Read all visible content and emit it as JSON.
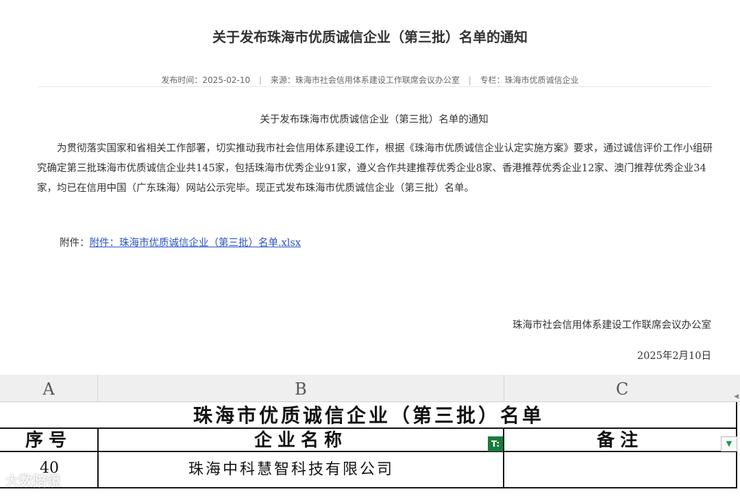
{
  "article": {
    "title": "关于发布珠海市优质诚信企业（第三批）名单的通知",
    "meta": {
      "publish_label": "发布时间：",
      "publish_date": "2025-02-10",
      "source_label": "来源：",
      "source": "珠海市社会信用体系建设工作联席会议办公室",
      "column_label": "专栏：",
      "column": "珠海市优质诚信企业",
      "separator": "|"
    },
    "subtitle": "关于发布珠海市优质诚信企业（第三批）名单的通知",
    "body": "为贯彻落实国家和省相关工作部署，切实推动我市社会信用体系建设工作，根据《珠海市优质诚信企业认定实施方案》要求，通过诚信评价工作小组研究确定第三批珠海市优质诚信企业共145家，包括珠海市优秀企业91家，遵义合作共建推荐优秀企业8家、香港推荐优秀企业12家、澳门推荐优秀企业34家，均已在信用中国（广东珠海）网站公示完毕。现正式发布珠海市优质诚信企业（第三批）名单。",
    "attachment_label": "附件：",
    "attachment_link": "附件：珠海市优质诚信企业（第三批）名单.xlsx",
    "signature_org": "珠海市社会信用体系建设工作联席会议办公室",
    "signature_date": "2025年2月10日"
  },
  "sheet": {
    "columns": [
      "A",
      "B",
      "C"
    ],
    "title": "珠海市优质诚信企业（第三批）名单",
    "headers": [
      "序号",
      "企业名称",
      "备注"
    ],
    "rows": [
      {
        "num": "40",
        "name": "珠海中科慧智科技有限公司",
        "remark": ""
      }
    ],
    "accent_color": "#1b7a3e",
    "filter_icon_glyph": "T:",
    "dropdown_glyph": "▼",
    "scroll_glyph": "◀"
  },
  "watermark": "大数陪镜",
  "icons": {
    "filter": "filter-active-icon",
    "dropdown": "filter-dropdown-icon",
    "scroll": "scroll-left-arrow-icon"
  }
}
